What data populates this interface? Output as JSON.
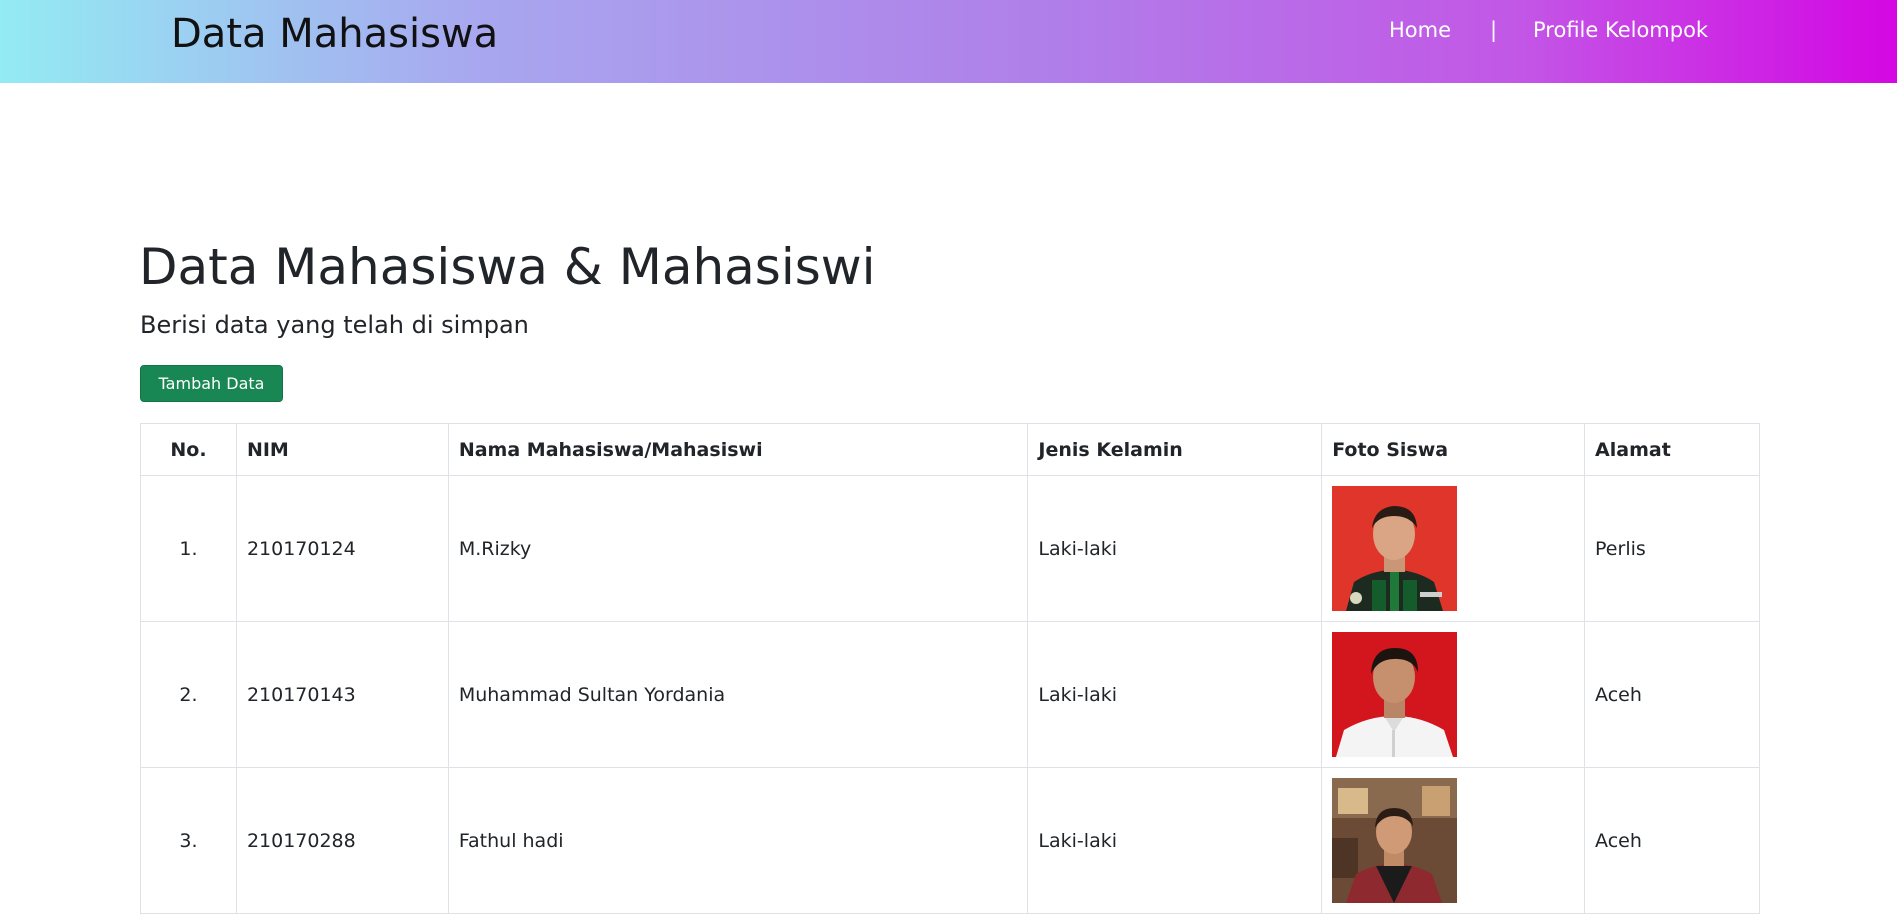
{
  "navbar": {
    "brand": "Data Mahasiswa",
    "links": [
      {
        "label": "Home"
      },
      {
        "label": "|"
      },
      {
        "label": "Profile Kelompok"
      }
    ]
  },
  "main": {
    "title": "Data Mahasiswa & Mahasiswi",
    "subtitle": "Berisi data yang telah di simpan",
    "add_button_label": "Tambah Data"
  },
  "table": {
    "headers": [
      "No.",
      "NIM",
      "Nama Mahasiswa/Mahasiswi",
      "Jenis Kelamin",
      "Foto Siswa",
      "Alamat"
    ],
    "rows": [
      {
        "no": "1.",
        "nim": "210170124",
        "nama": "M.Rizky",
        "jenis_kelamin": "Laki-laki",
        "alamat": "Perlis",
        "photo_bg": "#e0352b"
      },
      {
        "no": "2.",
        "nim": "210170143",
        "nama": "Muhammad Sultan Yordania",
        "jenis_kelamin": "Laki-laki",
        "alamat": "Aceh",
        "photo_bg": "#d3161d"
      },
      {
        "no": "3.",
        "nim": "210170288",
        "nama": "Fathul hadi",
        "jenis_kelamin": "Laki-laki",
        "alamat": "Aceh",
        "photo_bg": "#6b4a36"
      }
    ]
  },
  "colors": {
    "accent_green": "#198754",
    "gradient_start": "#93ebf3",
    "gradient_end": "#d407e3"
  }
}
